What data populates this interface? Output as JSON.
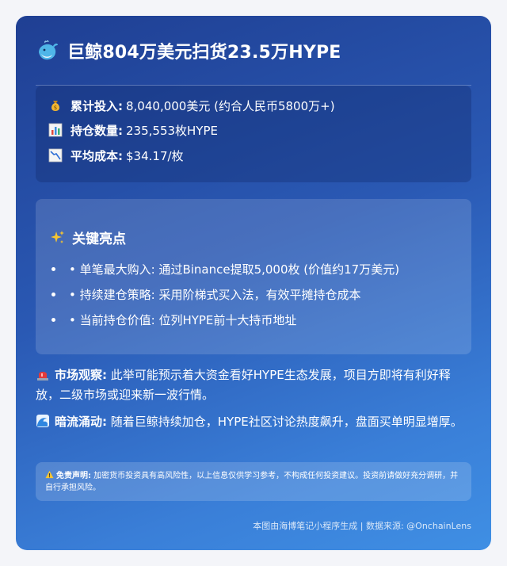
{
  "title": "巨鲸804万美元扫货23.5万HYPE",
  "stats": [
    {
      "icon": "money-bag-icon",
      "label": "累计投入:",
      "value": "8,040,000美元 (约合人民币5800万+)"
    },
    {
      "icon": "bar-chart-icon",
      "label": "持仓数量:",
      "value": "235,553枚HYPE"
    },
    {
      "icon": "chart-decreasing-icon",
      "label": "平均成本:",
      "value": "$34.17/枚"
    }
  ],
  "highlights": {
    "title": "关键亮点",
    "items": [
      "• 单笔最大购入: 通过Binance提取5,000枚 (价值约17万美元)",
      "• 持续建仓策略: 采用阶梯式买入法，有效平摊持仓成本",
      "• 当前持仓价值: 位列HYPE前十大持币地址"
    ]
  },
  "observation": {
    "label": "市场观察:",
    "text": " 此举可能预示着大资金看好HYPE生态发展，项目方即将有利好释放，二级市场或迎来新一波行情。"
  },
  "undercurrent": {
    "label": "暗流涌动:",
    "text": " 随着巨鲸持续加仓，HYPE社区讨论热度飙升，盘面买单明显增厚。"
  },
  "disclaimer": {
    "label": "免责声明:",
    "text": " 加密货币投资具有高风险性，以上信息仅供学习参考，不构成任何投资建议。投资前请做好充分调研，并自行承担风险。"
  },
  "footer": "本图由海博笔记小程序生成 | 数据来源: @OnchainLens"
}
